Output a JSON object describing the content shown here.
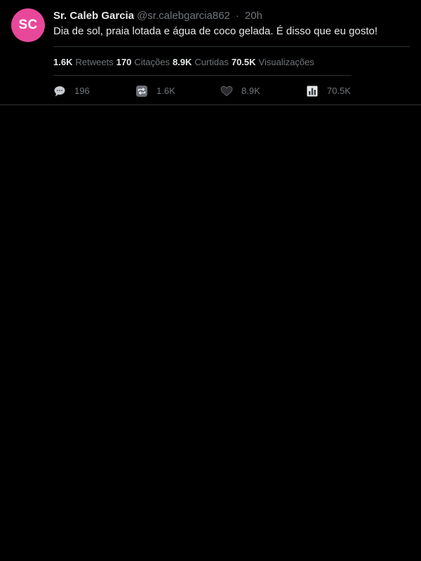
{
  "colors": {
    "background": "#000000",
    "avatar_bg": "#e8489a",
    "text_primary": "#e7e9ea",
    "text_secondary": "#71767b",
    "divider": "#2f3336"
  },
  "tweet": {
    "avatar_initials": "SC",
    "display_name": "Sr. Caleb Garcia",
    "handle": "@sr.calebgarcia862",
    "separator": "·",
    "time": "20h",
    "text": "Dia de sol, praia lotada e água de coco gelada. É disso que eu gosto!",
    "stats": [
      {
        "value": "1.6K",
        "label": "Retweets"
      },
      {
        "value": "170",
        "label": "Citações"
      },
      {
        "value": "8.9K",
        "label": "Curtidas"
      },
      {
        "value": "70.5K",
        "label": "Visualizações"
      }
    ],
    "actions": {
      "reply": {
        "icon": "speech-bubble-icon",
        "count": "196"
      },
      "retweet": {
        "icon": "retweet-icon",
        "count": "1.6K"
      },
      "like": {
        "icon": "heart-icon",
        "count": "8.9K"
      },
      "views": {
        "icon": "bar-chart-icon",
        "count": "70.5K"
      }
    }
  }
}
